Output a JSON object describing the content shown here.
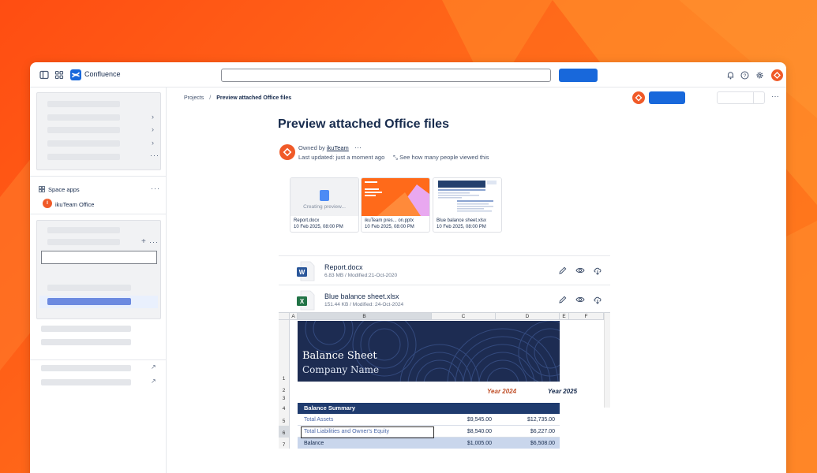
{
  "topbar": {
    "app_name": "Confluence",
    "search_placeholder": ""
  },
  "sidebar": {
    "space_apps_label": "Space apps",
    "app_item_label": "ikuTeam Office"
  },
  "breadcrumb": {
    "parent": "Projects",
    "separator": "/",
    "current": "Preview attached Office files"
  },
  "page": {
    "title": "Preview attached Office files",
    "owned_by_prefix": "Owned by",
    "owner_name": "ikuTeam",
    "last_updated": "Last updated: just a moment ago",
    "views_link": "See how many people viewed this"
  },
  "thumbnails": [
    {
      "name": "Report.docx",
      "date": "10 Feb 2025, 08:00 PM",
      "status": "Creating preview..."
    },
    {
      "name": "ikuTeam pres... on.pptx",
      "date": "10 Feb 2025, 08:00 PM",
      "status": ""
    },
    {
      "name": "Blue balance sheet.xlsx",
      "date": "10 Feb 2025, 08:00 PM",
      "status": ""
    }
  ],
  "files": [
    {
      "name": "Report.docx",
      "meta": "6.83 MB / Modified:21-Oct-2020",
      "icon_letter": "W"
    },
    {
      "name": "Blue balance sheet.xlsx",
      "meta": "151.44 KB / Modified: 24-Oct-2024",
      "icon_letter": "X"
    }
  ],
  "sheet": {
    "columns": [
      "A",
      "B",
      "C",
      "D",
      "E",
      "F"
    ],
    "rows": [
      "1",
      "2",
      "3",
      "4",
      "5",
      "6",
      "7"
    ],
    "title": "Balance Sheet",
    "subtitle": "Company Name",
    "year1": "Year 2024",
    "year2": "Year 2025",
    "summary_header": "Balance Summary",
    "summary_rows": [
      {
        "label": "Total Assets",
        "y2024": "$9,545.00",
        "y2025": "$12,735.00"
      },
      {
        "label": "Total Liabilities and Owner's Equity",
        "y2024": "$8,540.00",
        "y2025": "$6,227.00"
      },
      {
        "label": "Balance",
        "y2024": "$1,005.00",
        "y2025": "$6,508.00"
      }
    ]
  },
  "colors": {
    "background": "#ff5a1f",
    "brand_blue": "#1868db",
    "accent_orange": "#f05a28",
    "sheet_navy": "#1f3b6e",
    "year1_color": "#c0502a"
  },
  "icons": {
    "sidebar_toggle": "sidebar-icon",
    "app_switcher": "grid-icon",
    "notifications": "bell-icon",
    "help": "help-icon",
    "settings": "gear-icon",
    "edit": "pencil-icon",
    "preview": "eye-icon",
    "download": "cloud-download-icon"
  }
}
